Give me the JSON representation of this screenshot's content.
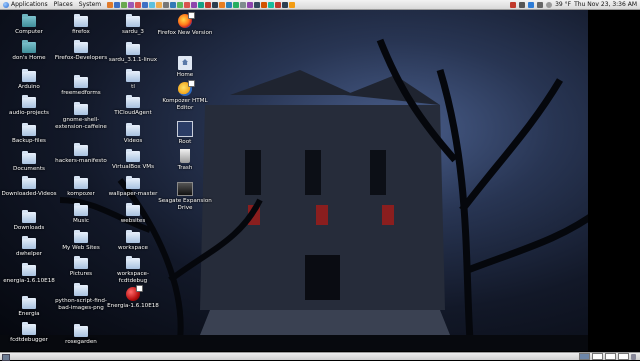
{
  "top_panel": {
    "menus": [
      "Applications",
      "Places",
      "System"
    ],
    "launcher_colors": [
      "#e07a2a",
      "#3d6fc4",
      "#6aa84f",
      "#9b59b6",
      "#d9534f",
      "#3d6fc4",
      "#5bc0de",
      "#f0ad4e",
      "#777777",
      "#337ab7",
      "#5cb85c",
      "#d9534f",
      "#8e44ad",
      "#16a085",
      "#c0392b",
      "#2c3e50",
      "#e67e22",
      "#2980b9",
      "#27ae60",
      "#7f8c8d",
      "#8e44ad",
      "#34495e",
      "#d35400",
      "#1abc9c",
      "#c0392b",
      "#2c3e50",
      "#f39c12"
    ],
    "weather": "39 °F",
    "datetime": "Thu Nov 23,  3:36 AM"
  },
  "desktop": {
    "columns": [
      [
        "Computer",
        "don's Home",
        "Arduino",
        "audio-projects",
        "Backup-files",
        "Documents",
        "Downloaded-Videos",
        "Downloads",
        "dwhelper",
        "energia-1.6.10E18",
        "Energia",
        "fcdtdebugger"
      ],
      [
        "firefox",
        "Firefox-Developers",
        "freemedforms",
        "gnome-shell-extension-caffeine",
        "hackers-manifesto",
        "kompozer",
        "Music",
        "My Web Sites",
        "Pictures",
        "python-script-find-bad-images-png",
        "rosegarden"
      ],
      [
        "sardu_3",
        "sardu_3.1.1-linux",
        "tl",
        "TlCloudAgent",
        "Videos",
        "VirtualBox VMs",
        "wallpaper-master",
        "websites",
        "workspace",
        "workspace-fcdtdebug",
        "Energia-1.6.10E18"
      ],
      [
        "Firefox New Version",
        "Home",
        "Kompozer HTML Editor",
        "Root",
        "Trash",
        "Seagate Expansion Drive"
      ]
    ]
  }
}
